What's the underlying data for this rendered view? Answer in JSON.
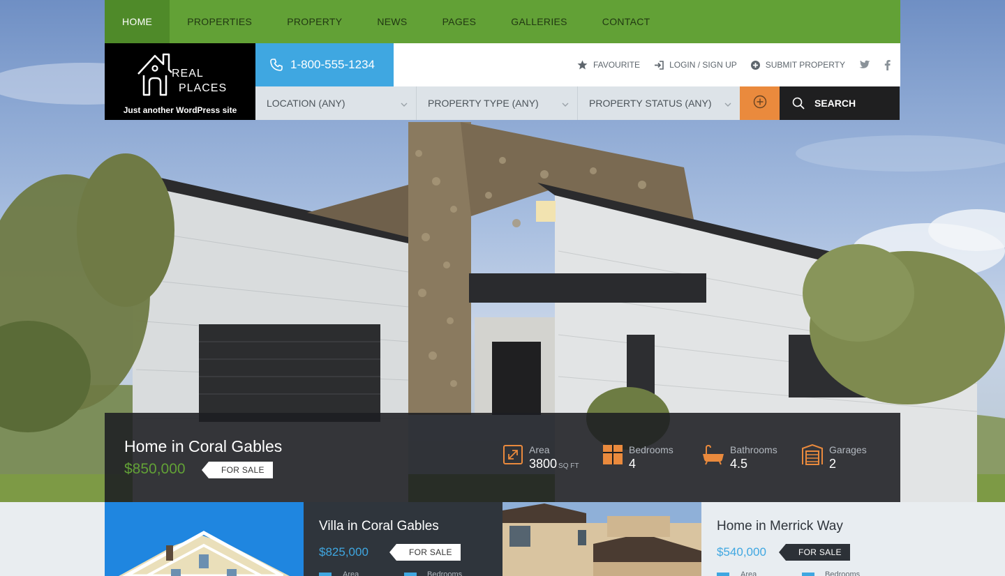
{
  "nav": {
    "items": [
      {
        "label": "HOME",
        "active": true
      },
      {
        "label": "PROPERTIES",
        "active": false
      },
      {
        "label": "PROPERTY",
        "active": false
      },
      {
        "label": "NEWS",
        "active": false
      },
      {
        "label": "PAGES",
        "active": false
      },
      {
        "label": "GALLERIES",
        "active": false
      },
      {
        "label": "CONTACT",
        "active": false
      }
    ]
  },
  "logo": {
    "line1": "REAL",
    "line2": "PLACES",
    "tagline": "Just another WordPress site",
    "icon": "house-logo-icon"
  },
  "phone": {
    "number": "1-800-555-1234",
    "icon": "phone-icon"
  },
  "utility": {
    "favourite": "FAVOURITE",
    "login": "LOGIN / SIGN UP",
    "submit": "SUBMIT PROPERTY",
    "social": [
      "twitter-icon",
      "facebook-icon"
    ]
  },
  "search": {
    "location": "LOCATION (ANY)",
    "type": "PROPERTY TYPE (ANY)",
    "status": "PROPERTY STATUS (ANY)",
    "button": "SEARCH"
  },
  "featured": {
    "title": "Home in Coral Gables",
    "price": "$850,000",
    "status": "FOR SALE",
    "meta": [
      {
        "label": "Area",
        "value": "3800",
        "unit": "SQ FT",
        "icon": "area-icon"
      },
      {
        "label": "Bedrooms",
        "value": "4",
        "icon": "bed-icon"
      },
      {
        "label": "Bathrooms",
        "value": "4.5",
        "icon": "bathtub-icon"
      },
      {
        "label": "Garages",
        "value": "2",
        "icon": "garage-icon"
      }
    ]
  },
  "cards": [
    {
      "title": "Villa in Coral Gables",
      "price": "$825,000",
      "status": "FOR SALE",
      "meta1": "Area",
      "meta2": "Bedrooms"
    },
    {
      "title": "Home in Merrick Way",
      "price": "$540,000",
      "status": "FOR SALE",
      "meta1": "Area",
      "meta2": "Bedrooms"
    }
  ],
  "colors": {
    "nav_green": "#62a136",
    "phone_blue": "#3fa7e1",
    "accent_orange": "#ea8a3d",
    "price_green": "#62a136",
    "price_blue": "#3fa7e1"
  }
}
